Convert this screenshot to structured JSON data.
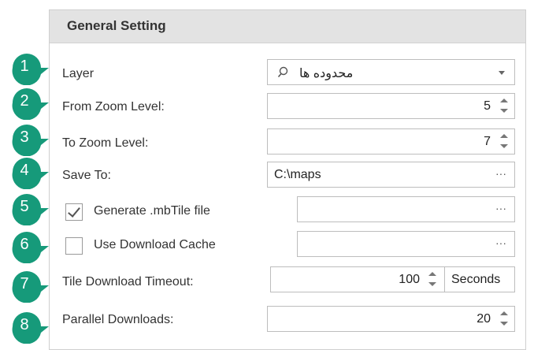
{
  "panel": {
    "title": "General Setting"
  },
  "badges": [
    "1",
    "2",
    "3",
    "4",
    "5",
    "6",
    "7",
    "8"
  ],
  "layer": {
    "label": "Layer",
    "value": "محدوده ها"
  },
  "from_zoom": {
    "label": "From Zoom Level:",
    "value": "5"
  },
  "to_zoom": {
    "label": "To Zoom Level:",
    "value": "7"
  },
  "save_to": {
    "label": "Save To:",
    "value": "C:\\maps",
    "browse": "···"
  },
  "generate_mbtile": {
    "label": "Generate .mbTile file",
    "checked": true,
    "value": "",
    "browse": "···"
  },
  "download_cache": {
    "label": "Use Download Cache",
    "checked": false,
    "value": "",
    "browse": "···"
  },
  "timeout": {
    "label": "Tile Download Timeout:",
    "value": "100",
    "unit": "Seconds"
  },
  "parallel": {
    "label": "Parallel Downloads:",
    "value": "20"
  },
  "colors": {
    "badge": "#169a7a",
    "header": "#e3e3e3",
    "border": "#bdbdbd"
  }
}
